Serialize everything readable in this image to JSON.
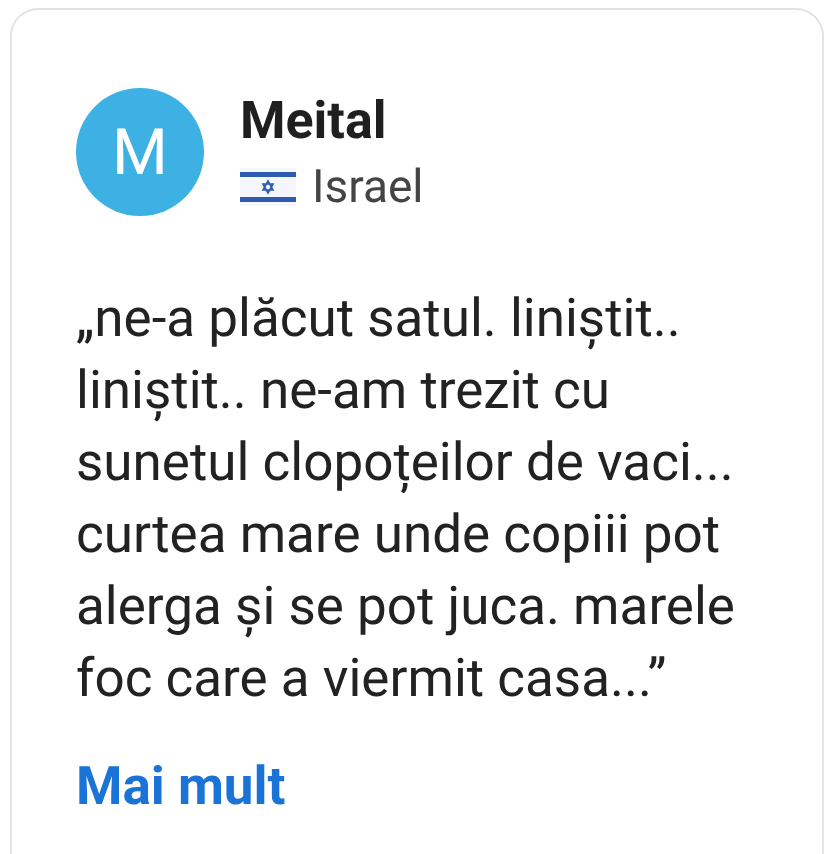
{
  "review": {
    "avatar_letter": "M",
    "name": "Meital",
    "country": "Israel",
    "text": "„ne-a plăcut satul. liniștit..\nliniștit.. ne-am trezit cu\nsunetul clopoțeilor de vaci...\ncurtea mare unde copiii pot\nalerga și se pot juca. marele\nfoc care a viermit casa...”",
    "more_link": "Mai mult"
  }
}
